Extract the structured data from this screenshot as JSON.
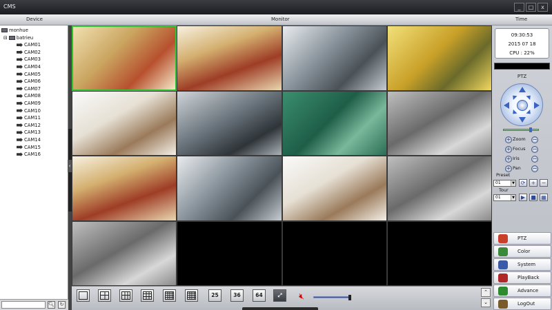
{
  "window": {
    "title": "CMS",
    "minimize": "_",
    "maximize": "□",
    "close": "x"
  },
  "sections": {
    "device": "Device",
    "monitor": "Monitor",
    "time": "Time"
  },
  "tree": {
    "root": "monhue",
    "group": "batrieu",
    "cameras": [
      "CAM01",
      "CAM02",
      "CAM03",
      "CAM04",
      "CAM05",
      "CAM06",
      "CAM07",
      "CAM08",
      "CAM09",
      "CAM10",
      "CAM11",
      "CAM12",
      "CAM13",
      "CAM14",
      "CAM15",
      "CAM16"
    ]
  },
  "clock": {
    "time": "09:30:53",
    "date": "2015 07 18",
    "cpu": "CPU : 22%"
  },
  "ptz": {
    "title": "PTZ",
    "speed_level": 0.75,
    "controls": [
      {
        "label": "Zoom",
        "plus": "+",
        "minus": "−"
      },
      {
        "label": "Focus",
        "plus": "+",
        "minus": "−"
      },
      {
        "label": "Iris",
        "plus": "+",
        "minus": "−"
      },
      {
        "label": "Pan",
        "plus": "+",
        "minus": "−"
      }
    ],
    "preset_label": "Preset",
    "preset_value": "01",
    "tour_label": "Tour",
    "tour_value": "01"
  },
  "menu": [
    {
      "label": "PTZ",
      "icon": "ptz-icon",
      "color": "#c8402a"
    },
    {
      "label": "Color",
      "icon": "color-icon",
      "color": "#3a8a3a"
    },
    {
      "label": "System",
      "icon": "system-icon",
      "color": "#3a5aa8"
    },
    {
      "label": "PlayBack",
      "icon": "playback-icon",
      "color": "#b02828"
    },
    {
      "label": "Advance",
      "icon": "advance-icon",
      "color": "#2e8a2e"
    },
    {
      "label": "LogOut",
      "icon": "logout-icon",
      "color": "#7a5a2a"
    }
  ],
  "layouts": [
    {
      "name": "layout-1",
      "label": ""
    },
    {
      "name": "layout-4",
      "label": ""
    },
    {
      "name": "layout-6",
      "label": ""
    },
    {
      "name": "layout-9",
      "label": ""
    },
    {
      "name": "layout-13",
      "label": ""
    },
    {
      "name": "layout-16",
      "label": ""
    },
    {
      "name": "layout-25",
      "label": "25"
    },
    {
      "name": "layout-36",
      "label": "36"
    },
    {
      "name": "layout-64",
      "label": "64"
    },
    {
      "name": "fullscreen",
      "label": ""
    }
  ],
  "volume": {
    "level": 0.95
  },
  "accent_color": "#31c431"
}
